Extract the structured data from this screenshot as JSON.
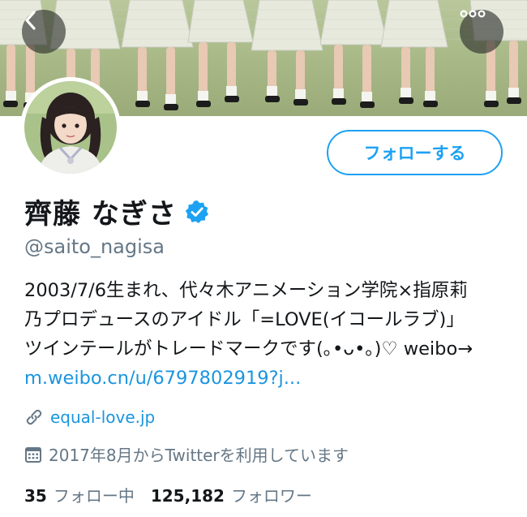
{
  "header": {
    "back_icon": "chevron-left-icon",
    "more_icon": "more-horizontal-icon"
  },
  "profile": {
    "name": "齊藤 なぎさ",
    "verified": true,
    "handle": "@saito_nagisa",
    "follow_button_label": "フォローする",
    "bio": {
      "line1": "2003/7/6生まれ、代々木アニメーション学院×指原莉",
      "line2": "乃プロデュースのアイドル「=LOVE(イコールラブ)」",
      "line3": "ツインテールがトレードマークです(｡•ᴗ•｡)♡ weibo→",
      "link": "m.weibo.cn/u/6797802919?j..."
    },
    "website": "equal-love.jp",
    "joined": "2017年8月からTwitterを利用しています"
  },
  "stats": {
    "following_count": "35",
    "following_label": "フォロー中",
    "followers_count": "125,182",
    "followers_label": "フォロワー"
  },
  "colors": {
    "accent": "#1da1f2",
    "link": "#1b95e0",
    "muted": "#657786",
    "text": "#14171a"
  }
}
